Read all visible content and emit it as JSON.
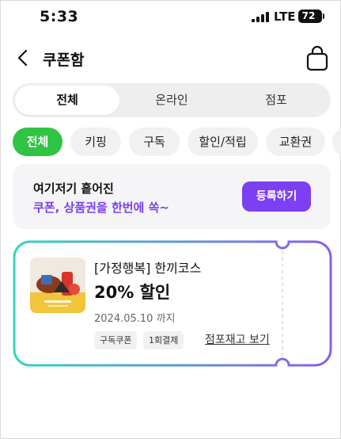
{
  "status_bar": {
    "time": "5:33",
    "network": "LTE",
    "battery": "72"
  },
  "header": {
    "title": "쿠폰함",
    "back_icon": "chevron-left-icon",
    "bag_icon": "shopping-bag-icon"
  },
  "segment_tabs": [
    {
      "label": "전체",
      "active": true
    },
    {
      "label": "온라인",
      "active": false
    },
    {
      "label": "점포",
      "active": false
    }
  ],
  "filter_chips": [
    {
      "label": "전체",
      "active": true
    },
    {
      "label": "키핑",
      "active": false
    },
    {
      "label": "구독",
      "active": false
    },
    {
      "label": "할인/적립",
      "active": false
    },
    {
      "label": "교환권",
      "active": false
    }
  ],
  "banner": {
    "title": "여기저기 흩어진",
    "subtitle": "쿠폰, 상품권을 한번에 쏙~",
    "button_label": "등록하기"
  },
  "coupons": [
    {
      "title": "[가정행복] 한끼코스",
      "discount": "20% 할인",
      "expiry": "2024.05.10 까지",
      "tags": [
        "구독쿠폰",
        "1회결제"
      ],
      "link_label": "점포재고 보기"
    }
  ],
  "colors": {
    "accent_green": "#2fc443",
    "accent_purple": "#7d3ff2",
    "gradient_start": "#33d6b8",
    "gradient_end": "#8a5cf0"
  }
}
